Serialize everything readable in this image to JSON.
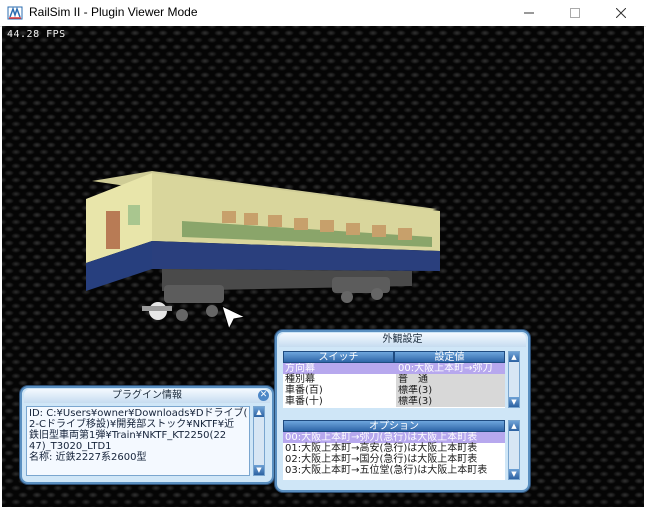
{
  "window": {
    "title": "RailSim II - Plugin Viewer Mode",
    "app_icon": "railsim-icon",
    "controls": [
      "minimize",
      "maximize",
      "close"
    ]
  },
  "viewport": {
    "fps": "44.28 FPS"
  },
  "plugin_info_panel": {
    "title": "プラグイン情報",
    "text_lines": [
      "ID: C:¥Users¥owner¥Downloads¥Dドライブ(",
      "2-Cドライブ移設)¥開発部ストック¥NKTF¥近",
      "鉄旧型車両第1弾¥Train¥NKTF_KT2250(22",
      "47)_T3020_LTD1",
      "名称: 近鉄2227系2600型"
    ]
  },
  "appearance_panel": {
    "title": "外観設定",
    "columns": [
      "スイッチ",
      "設定値"
    ],
    "rows": [
      {
        "switch": "方向幕",
        "value": "00:大阪上本町→弥刀",
        "selected": true
      },
      {
        "switch": "種別幕",
        "value": "普　通",
        "selected": false
      },
      {
        "switch": "車番(百)",
        "value": "標準(3)",
        "selected": false
      },
      {
        "switch": "車番(十)",
        "value": "標準(3)",
        "selected": false
      }
    ],
    "options_header": "オプション",
    "options": [
      {
        "label": "00:大阪上本町→弥刀(急行)は大阪上本町表",
        "selected": true
      },
      {
        "label": "01:大阪上本町→高安(急行)は大阪上本町表",
        "selected": false
      },
      {
        "label": "02:大阪上本町→国分(急行)は大阪上本町表",
        "selected": false
      },
      {
        "label": "03:大阪上本町→五位堂(急行)は大阪上本町表",
        "selected": false
      }
    ]
  },
  "colors": {
    "train_cream": "#e6e3a8",
    "train_blue": "#233a78",
    "panel_bg": "#cfe6f7",
    "panel_border": "#5a8fc0",
    "selection": "#b7a8ee"
  }
}
